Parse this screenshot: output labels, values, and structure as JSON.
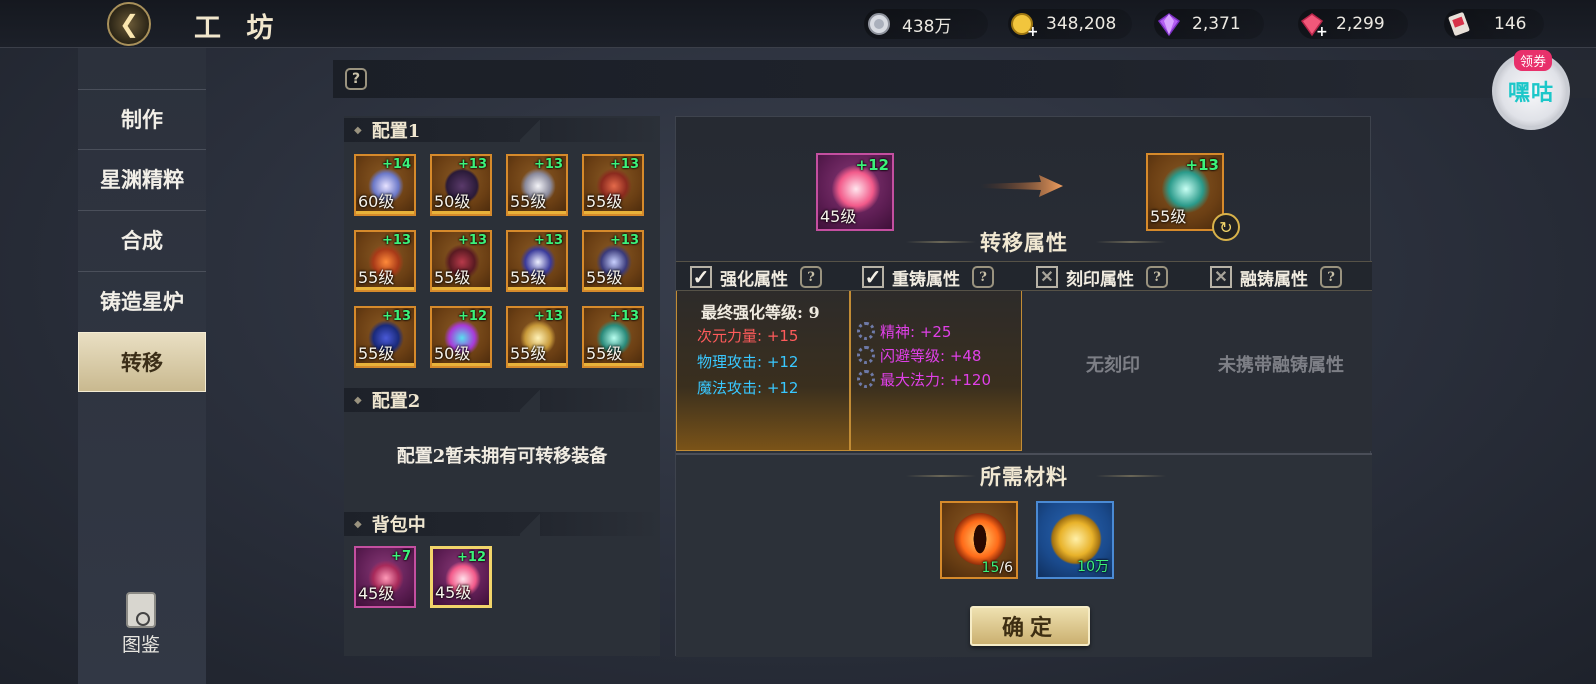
{
  "header": {
    "title": "工 坊",
    "resources": [
      {
        "icon": "silver-coin-icon",
        "value": "438万"
      },
      {
        "icon": "gold-coin-add-icon",
        "value": "348,208"
      },
      {
        "icon": "purple-diamond-icon",
        "value": "2,371"
      },
      {
        "icon": "red-diamond-add-icon",
        "value": "2,299"
      },
      {
        "icon": "ticket-icon",
        "value": "146"
      }
    ]
  },
  "nav": {
    "items": [
      {
        "label": "制作",
        "active": false
      },
      {
        "label": "星渊精粹",
        "active": false
      },
      {
        "label": "合成",
        "active": false
      },
      {
        "label": "铸造星炉",
        "active": false
      },
      {
        "label": "转移",
        "active": true
      }
    ],
    "catalog_label": "图鉴"
  },
  "promo": {
    "tag": "领券",
    "text": "嘿咕"
  },
  "config1": {
    "title": "配置1",
    "items": [
      {
        "level": "60级",
        "plus": "+14"
      },
      {
        "level": "50级",
        "plus": "+13"
      },
      {
        "level": "55级",
        "plus": "+13"
      },
      {
        "level": "55级",
        "plus": "+13"
      },
      {
        "level": "55级",
        "plus": "+13"
      },
      {
        "level": "55级",
        "plus": "+13"
      },
      {
        "level": "55级",
        "plus": "+13"
      },
      {
        "level": "55级",
        "plus": "+13"
      },
      {
        "level": "55级",
        "plus": "+13"
      },
      {
        "level": "50级",
        "plus": "+12"
      },
      {
        "level": "55级",
        "plus": "+13"
      },
      {
        "level": "55级",
        "plus": "+13"
      }
    ]
  },
  "config2": {
    "title": "配置2",
    "empty_text": "配置2暂未拥有可转移装备"
  },
  "bag": {
    "title": "背包中",
    "items": [
      {
        "level": "45级",
        "plus": "+7"
      },
      {
        "level": "45级",
        "plus": "+12"
      }
    ]
  },
  "transfer": {
    "source": {
      "level": "45级",
      "plus": "+12"
    },
    "target": {
      "level": "55级",
      "plus": "+13"
    },
    "section_title": "转移属性",
    "tabs": [
      {
        "label": "强化属性",
        "checked": true
      },
      {
        "label": "重铸属性",
        "checked": true
      },
      {
        "label": "刻印属性",
        "checked": false
      },
      {
        "label": "融铸属性",
        "checked": false
      }
    ],
    "enhance": {
      "final_level": "最终强化等级: 9",
      "stats": [
        {
          "text": "次元力量: +15",
          "color": "#ff5b5b"
        },
        {
          "text": "物理攻击: +12",
          "color": "#39c8ff"
        },
        {
          "text": "魔法攻击: +12",
          "color": "#39c8ff"
        }
      ]
    },
    "reforge": {
      "stats": [
        {
          "text": "精神: +25",
          "color": "#e040e8"
        },
        {
          "text": "闪避等级: +48",
          "color": "#e040e8"
        },
        {
          "text": "最大法力: +120",
          "color": "#e040e8"
        }
      ]
    },
    "engrave_empty": "无刻印",
    "fuse_empty": "未携带融铸属性",
    "materials_title": "所需材料",
    "materials": [
      {
        "count_have": "15",
        "count_need": "/6"
      },
      {
        "count": "10万"
      }
    ],
    "confirm_label": "确定"
  }
}
